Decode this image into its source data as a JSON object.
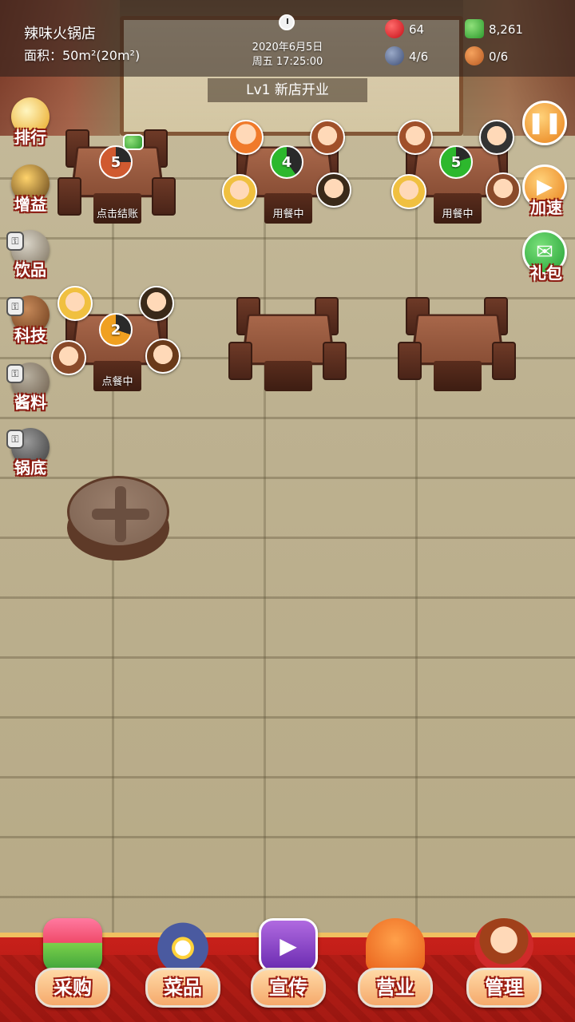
{
  "header": {
    "shop_name": "辣味火锅店",
    "shop_area": "面积：50m²(20m²)",
    "date": "2020年6月5日",
    "time": "周五 17:25:00",
    "level_banner": "Lv1 新店开业"
  },
  "resources": {
    "hearts": "64",
    "cash": "8,261",
    "tables": "4/6",
    "staff": "0/6"
  },
  "left_menu": [
    {
      "label": "排行",
      "icon": "trophy-icon",
      "locked": false
    },
    {
      "label": "增益",
      "icon": "buff-icon",
      "locked": false
    },
    {
      "label": "饮品",
      "icon": "drink-icon",
      "locked": true
    },
    {
      "label": "科技",
      "icon": "book-icon",
      "locked": true
    },
    {
      "label": "酱料",
      "icon": "sauce-icon",
      "locked": true
    },
    {
      "label": "锅底",
      "icon": "pot-icon",
      "locked": true
    }
  ],
  "right_menu": {
    "speed_label": "加速",
    "gift_label": "礼包"
  },
  "tables": [
    {
      "count": "5",
      "status": "点击结账"
    },
    {
      "count": "4",
      "status": "用餐中"
    },
    {
      "count": "5",
      "status": "用餐中"
    },
    {
      "count": "2",
      "status": "点餐中"
    }
  ],
  "bottom_nav": [
    {
      "label": "采购",
      "icon": "shop-stall-icon"
    },
    {
      "label": "菜品",
      "icon": "dish-icon"
    },
    {
      "label": "宣传",
      "icon": "video-icon"
    },
    {
      "label": "营业",
      "icon": "bell-icon"
    },
    {
      "label": "管理",
      "icon": "manager-icon"
    }
  ],
  "colors": {
    "accent_red": "#c8201a",
    "gold_trim": "#f0c060",
    "dining_green": "#2db82d",
    "ordering_orange": "#f0a020",
    "checkout_red": "#d05a30"
  }
}
